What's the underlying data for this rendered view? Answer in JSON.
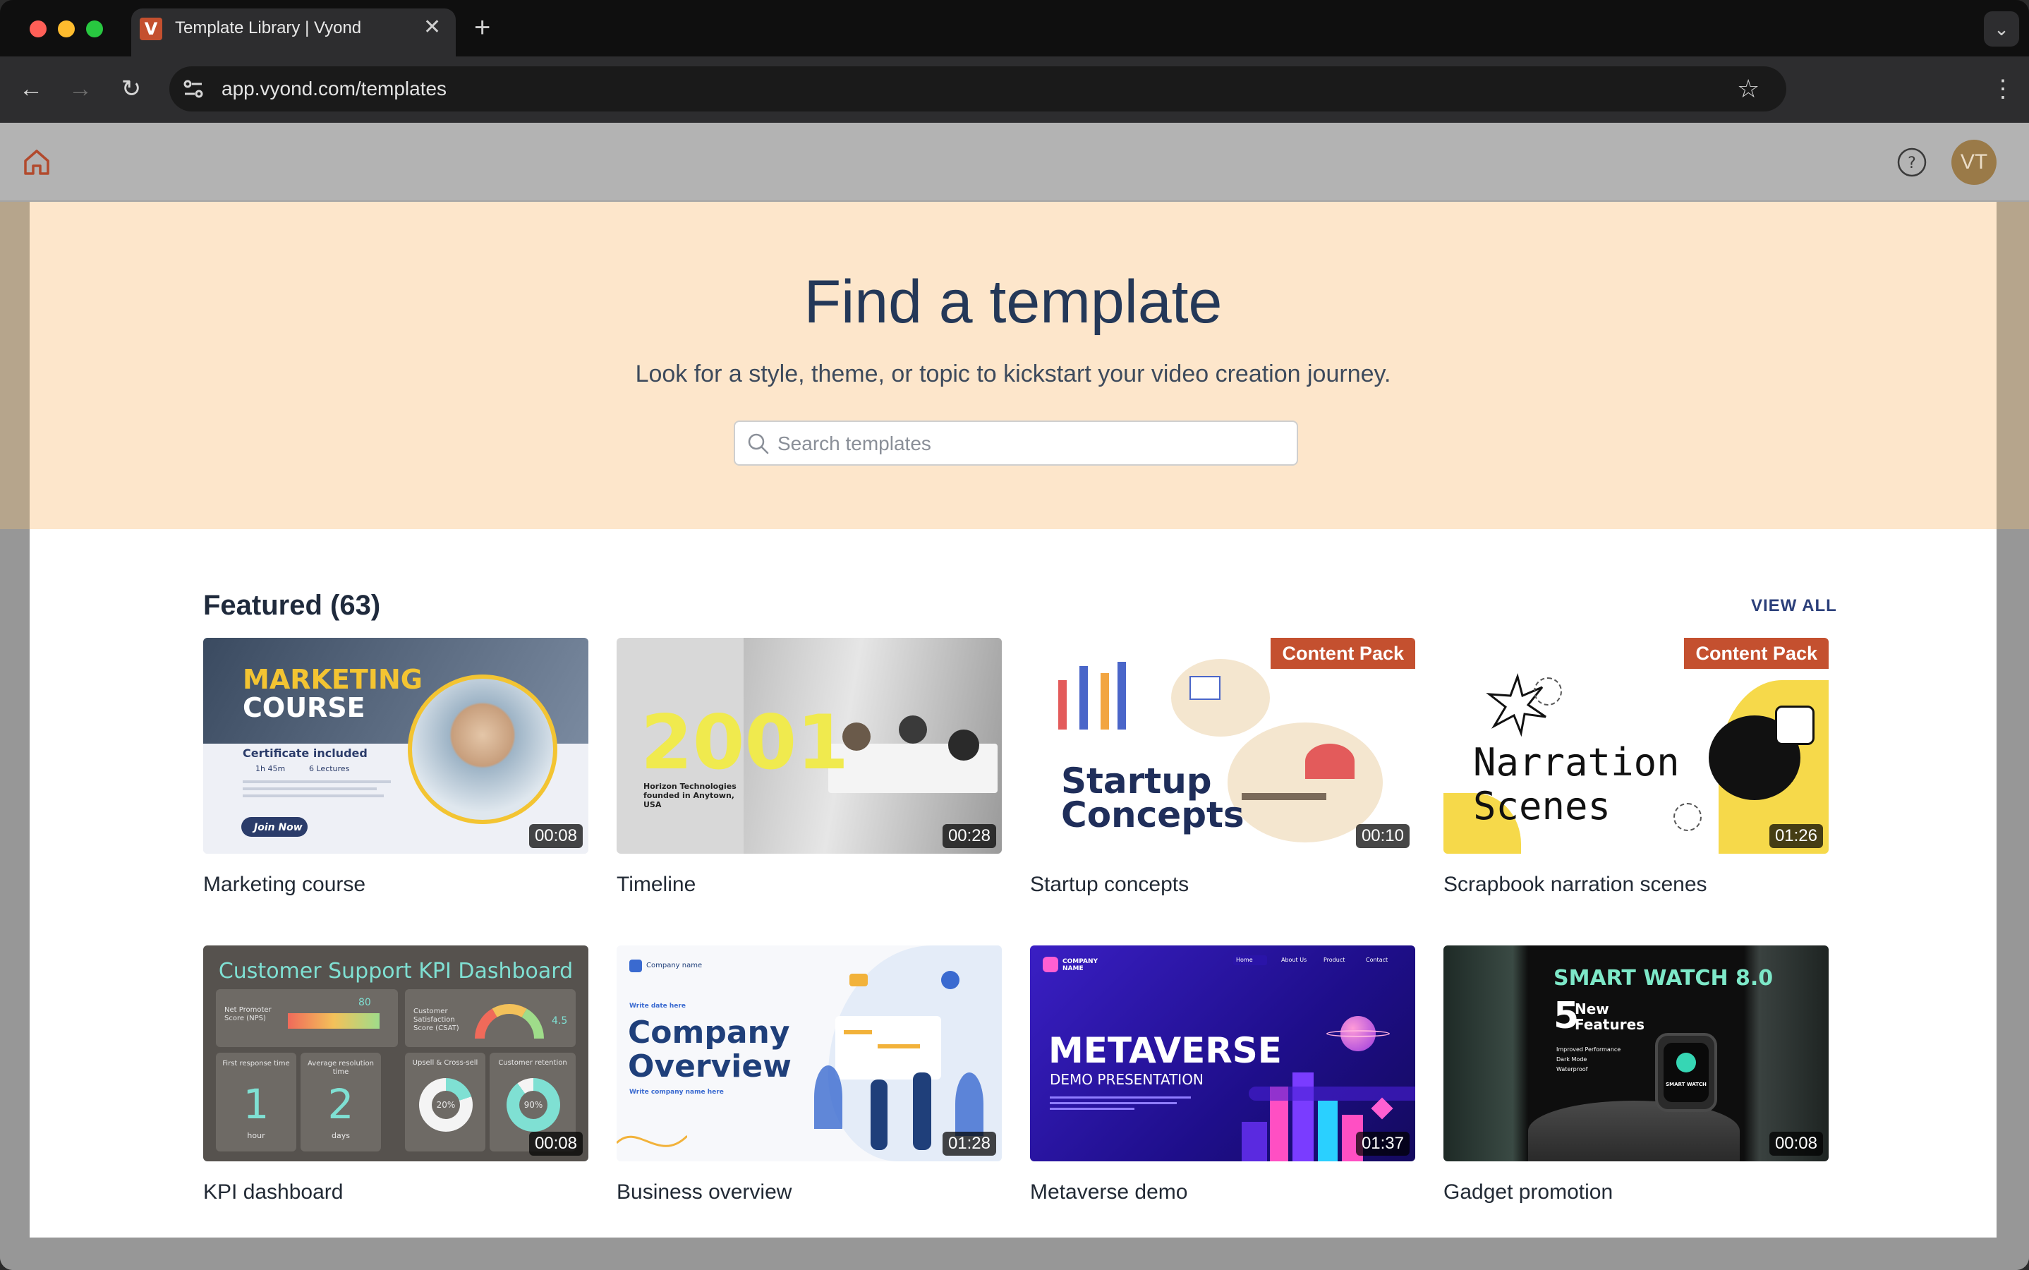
{
  "browser": {
    "tab_title": "Template Library | Vyond",
    "tab_favicon": "V",
    "url": "app.vyond.com/templates"
  },
  "appbar": {
    "avatar_initials": "VT"
  },
  "hero": {
    "title": "Find a template",
    "subtitle": "Look for a style, theme, or topic to kickstart your video creation journey.",
    "search_placeholder": "Search templates"
  },
  "featured": {
    "title": "Featured (63)",
    "view_all": "VIEW ALL",
    "cards": [
      {
        "label": "Marketing course",
        "duration": "00:08",
        "badge": "",
        "thumb": {
          "headline1": "MARKETING",
          "headline2": "COURSE",
          "line1": "Certificate included",
          "line2": "1h 45m",
          "line3": "6 Lectures",
          "cta": "Join Now"
        }
      },
      {
        "label": "Timeline",
        "duration": "00:28",
        "badge": "",
        "thumb": {
          "year": "2001",
          "caption": "Horizon Technologies founded in Anytown, USA"
        }
      },
      {
        "label": "Startup concepts",
        "duration": "00:10",
        "badge": "Content Pack",
        "thumb": {
          "headline1": "Startup",
          "headline2": "Concepts"
        }
      },
      {
        "label": "Scrapbook narration scenes",
        "duration": "01:26",
        "badge": "Content Pack",
        "thumb": {
          "headline1": "Narration",
          "headline2": "Scenes"
        }
      },
      {
        "label": "KPI dashboard",
        "duration": "00:08",
        "badge": "",
        "thumb": {
          "title": "Customer Support KPI Dashboard",
          "nps": "Net Promoter Score (NPS)",
          "csat": "Customer Satisfaction Score (CSAT)",
          "frt": "First response time",
          "art": "Average resolution time",
          "upsell": "Upsell & Cross-sell",
          "retention": "Customer retention",
          "v1": "1",
          "v1unit": "hour",
          "v2": "2",
          "v2unit": "days",
          "p1": "20%",
          "p2": "90%",
          "nps_val": "80",
          "csat_val": "4.5"
        }
      },
      {
        "label": "Business overview",
        "duration": "01:28",
        "badge": "",
        "thumb": {
          "company": "Company name",
          "date": "Write date here",
          "headline1": "Company",
          "headline2": "Overview",
          "byline": "Write company name here"
        }
      },
      {
        "label": "Metaverse demo",
        "duration": "01:37",
        "badge": "",
        "thumb": {
          "company": "COMPANY NAME",
          "nav": [
            "Home",
            "About Us",
            "Product",
            "Contact"
          ],
          "headline": "METAVERSE",
          "sub": "DEMO PRESENTATION"
        }
      },
      {
        "label": "Gadget promotion",
        "duration": "00:08",
        "badge": "",
        "thumb": {
          "headline": "SMART WATCH 8.0",
          "big": "5",
          "feat1": "New",
          "feat2": "Features",
          "bullets": [
            "Improved Performance",
            "Dark Mode",
            "Waterproof"
          ],
          "brand": "SMART WATCH"
        }
      }
    ]
  },
  "colors": {
    "hero_bg": "#fde6cb",
    "accent": "#c4502f",
    "heading": "#243858"
  }
}
